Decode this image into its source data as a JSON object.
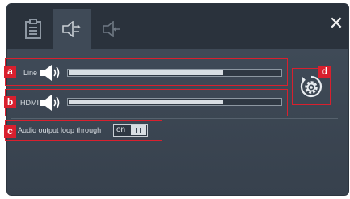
{
  "tabs": [
    {
      "icon": "clipboard-icon",
      "active": false
    },
    {
      "icon": "speaker-output-icon",
      "active": true
    },
    {
      "icon": "speaker-input-icon",
      "active": false
    }
  ],
  "close_label": "✕",
  "rows": {
    "line": {
      "marker": "a",
      "label": "Line",
      "volume_fraction": 0.73
    },
    "hdmi": {
      "marker": "b",
      "label": "HDMI",
      "volume_fraction": 0.73
    }
  },
  "loop": {
    "marker": "c",
    "label": "Audio output loop through",
    "state": "on"
  },
  "reset": {
    "marker": "d",
    "icon": "reset-gear-icon"
  },
  "colors": {
    "annotation": "#d9202e",
    "panel": "#3b4653",
    "topbar": "#2a323c"
  }
}
